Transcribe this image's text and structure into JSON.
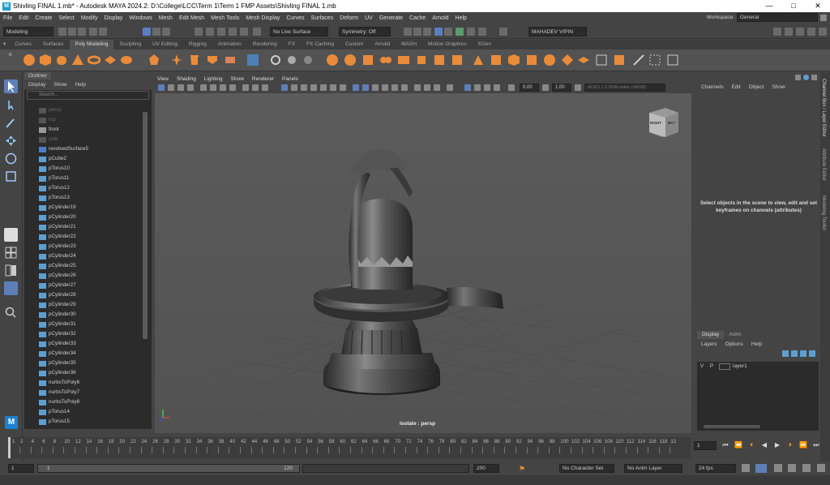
{
  "title_bar": {
    "title": "Shivling FINAL 1.mb* - Autodesk MAYA 2024.2: D:\\College\\LCC\\Term 1\\Term 1 FMP Assets\\Shivling FINAL 1.mb",
    "min": "—",
    "max": "□",
    "close": "✕"
  },
  "menubar": [
    "File",
    "Edit",
    "Create",
    "Select",
    "Modify",
    "Display",
    "Windows",
    "Mesh",
    "Edit Mesh",
    "Mesh Tools",
    "Mesh Display",
    "Curves",
    "Surfaces",
    "Deform",
    "UV",
    "Generate",
    "Cache",
    "Arnold",
    "Help"
  ],
  "workspace": {
    "label": "Workspace:",
    "value": "General"
  },
  "status": {
    "mode": "Modeling",
    "live_surface": "No Live Surface",
    "symmetry": "Symmetry: Off",
    "user": "MAHADEV VIPIN"
  },
  "shelf_tabs": [
    "Curves",
    "Surfaces",
    "Poly Modeling",
    "Sculpting",
    "UV Editing",
    "Rigging",
    "Animation",
    "Rendering",
    "FX",
    "FX Caching",
    "Custom",
    "Arnold",
    "MASH",
    "Motion Graphics",
    "XGen"
  ],
  "shelf_active": "Poly Modeling",
  "outliner": {
    "tab": "Outliner",
    "menus": [
      "Display",
      "Show",
      "Help"
    ],
    "search_placeholder": "Search...",
    "items": [
      {
        "name": "persp",
        "dim": true
      },
      {
        "name": "top",
        "dim": true
      },
      {
        "name": "front",
        "dim": false
      },
      {
        "name": "side",
        "dim": true
      },
      {
        "name": "revolvedSurface5"
      },
      {
        "name": "pCube2"
      },
      {
        "name": "pTorus10"
      },
      {
        "name": "pTorus11"
      },
      {
        "name": "pTorus12"
      },
      {
        "name": "pTorus13"
      },
      {
        "name": "pCylinder19"
      },
      {
        "name": "pCylinder20"
      },
      {
        "name": "pCylinder21"
      },
      {
        "name": "pCylinder22"
      },
      {
        "name": "pCylinder23"
      },
      {
        "name": "pCylinder24"
      },
      {
        "name": "pCylinder25"
      },
      {
        "name": "pCylinder26"
      },
      {
        "name": "pCylinder27"
      },
      {
        "name": "pCylinder28"
      },
      {
        "name": "pCylinder29"
      },
      {
        "name": "pCylinder30"
      },
      {
        "name": "pCylinder31"
      },
      {
        "name": "pCylinder32"
      },
      {
        "name": "pCylinder33"
      },
      {
        "name": "pCylinder34"
      },
      {
        "name": "pCylinder35"
      },
      {
        "name": "pCylinder36"
      },
      {
        "name": "nurbsToPoly6"
      },
      {
        "name": "nurbsToPoly7"
      },
      {
        "name": "nurbsToPoly8"
      },
      {
        "name": "pTorus14"
      },
      {
        "name": "pTorus15"
      }
    ]
  },
  "viewport": {
    "menus": [
      "View",
      "Shading",
      "Lighting",
      "Show",
      "Renderer",
      "Panels"
    ],
    "exposure": "0.00",
    "gamma": "1.00",
    "colorspace": "ACES 1.0 SDR-video (sRGB)",
    "camera_label": "Isolate : persp",
    "viewcube_left": "RIGHT",
    "viewcube_right": "BKT"
  },
  "channel_box": {
    "menus": [
      "Channels",
      "Edit",
      "Object",
      "Show"
    ],
    "message": "Select objects in the scene to view, edit and set keyframes on channels (attributes)"
  },
  "side_tabs": [
    "Channel Box / Layer Editor",
    "Attribute Editor",
    "Modeling Toolkit"
  ],
  "layers": {
    "tabs": [
      "Display",
      "Anim"
    ],
    "menus": [
      "Layers",
      "Options",
      "Help"
    ],
    "rows": [
      {
        "v": "V",
        "p": "P",
        "name": "layer1"
      }
    ]
  },
  "timeline": {
    "ticks": [
      "2",
      "4",
      "6",
      "8",
      "10",
      "12",
      "14",
      "16",
      "18",
      "20",
      "22",
      "24",
      "26",
      "28",
      "30",
      "32",
      "34",
      "36",
      "38",
      "40",
      "42",
      "44",
      "46",
      "48",
      "50",
      "52",
      "54",
      "56",
      "58",
      "60",
      "62",
      "64",
      "66",
      "68",
      "70",
      "72",
      "74",
      "76",
      "78",
      "80",
      "82",
      "84",
      "86",
      "88",
      "90",
      "92",
      "94",
      "96",
      "98",
      "100",
      "102",
      "104",
      "106",
      "108",
      "110",
      "112",
      "114",
      "116",
      "118",
      "12"
    ],
    "first_tick": "1",
    "current_frame": "1"
  },
  "range": {
    "start": "1",
    "range_start": "1",
    "range_end": "120",
    "end": "200",
    "character_set": "No Character Set",
    "anim_layer": "No Anim Layer",
    "fps": "24 fps"
  },
  "colors": {
    "accent": "#e88b3a",
    "panel": "#444444",
    "viewport": "#5a5a5a",
    "outliner_bg": "#2b2b2b"
  }
}
